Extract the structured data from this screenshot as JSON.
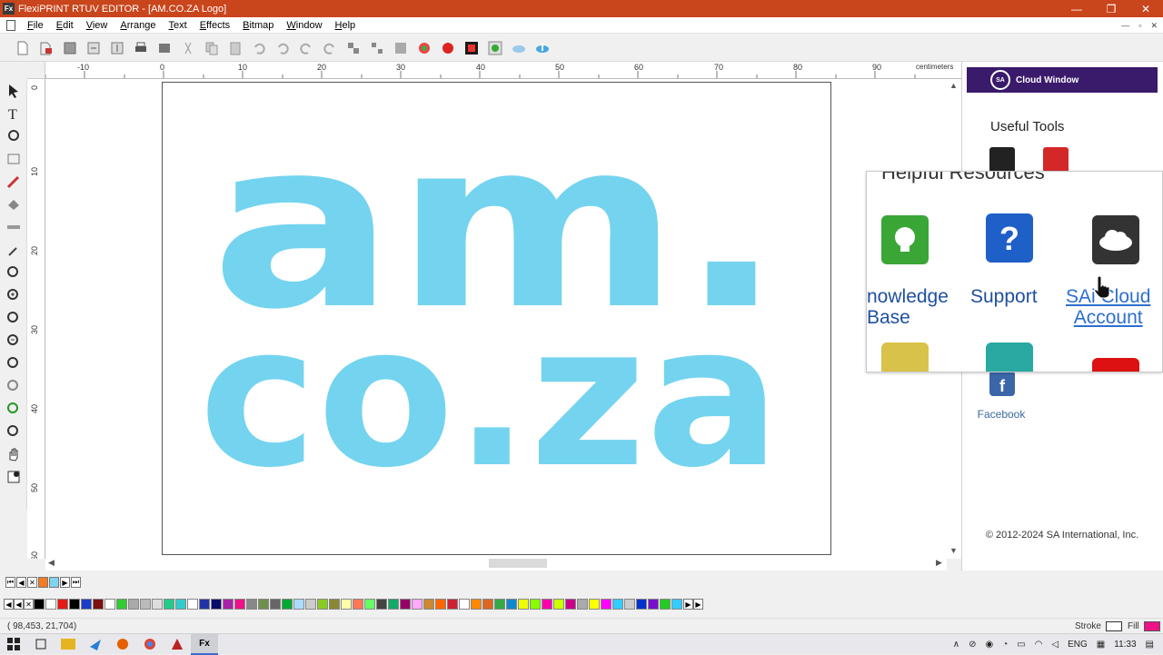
{
  "window": {
    "title": "FlexiPRINT RTUV EDITOR - [AM.CO.ZA Logo]",
    "app_icon_text": "Fx",
    "controls": [
      "—",
      "❐",
      "✕"
    ]
  },
  "menu": {
    "items": [
      "File",
      "Edit",
      "View",
      "Arrange",
      "Text",
      "Effects",
      "Bitmap",
      "Window",
      "Help"
    ],
    "mdi_controls": [
      "—",
      "▫",
      "✕"
    ]
  },
  "ruler": {
    "unit": "centimeters",
    "h_labels": [
      "-10",
      "0",
      "10",
      "20",
      "30",
      "40",
      "50",
      "60",
      "70",
      "80",
      "90"
    ],
    "v_labels": [
      "0",
      "10",
      "20",
      "30",
      "40",
      "50",
      "60"
    ]
  },
  "logo": {
    "line1": "am.",
    "line2": "co.za",
    "color": "#74d4ef"
  },
  "cloud_panel": {
    "header": "Cloud Window",
    "logo_text": "SA",
    "useful_tools": "Useful Tools",
    "helpful_resources": "Helpful Resources",
    "resources": [
      {
        "label": "nowledge\nBase",
        "icon": "lightbulb-icon",
        "color": "#3aa636"
      },
      {
        "label": "Support",
        "icon": "question-icon",
        "color": "#1f5fc8"
      },
      {
        "label": "SAi Cloud\nAccount",
        "icon": "cloud-icon",
        "color": "#333333"
      }
    ],
    "facebook": "Facebook",
    "copyright": "© 2012-2024 SA International, Inc."
  },
  "status": {
    "coords": "( 98,453,   21,704)",
    "stroke_label": "Stroke",
    "fill_label": "Fill",
    "fill_color": "#ee1188"
  },
  "taskbar": {
    "active_app": "Fx",
    "lang": "ENG",
    "time": "11:33"
  },
  "palette": {
    "colors": [
      "#000000",
      "#ffffff",
      "#e41b17",
      "#000000",
      "#1a3cc8",
      "#7a1010",
      "#ffffff",
      "#33cc33",
      "#aaaaaa",
      "#bbbbbb",
      "#dddddd",
      "#22cc88",
      "#33cccc",
      "#ffffff",
      "#2233aa",
      "#0a0a6a",
      "#aa22aa",
      "#ee1188",
      "#888888",
      "#6f8f4f",
      "#666666",
      "#00aa33",
      "#aaddff",
      "#cccccc",
      "#88cc22",
      "#888833",
      "#ffffaa",
      "#ff7755",
      "#66ff66",
      "#444444",
      "#11aa66",
      "#990066",
      "#ffaaff",
      "#cc8833",
      "#ff6600",
      "#cc2233",
      "#ffffff",
      "#ff8800",
      "#dd6622",
      "#33aa44",
      "#1188cc",
      "#eeff00",
      "#88ff00",
      "#ff00aa",
      "#ccff00",
      "#cc0088",
      "#aaaaaa",
      "#ffff00",
      "#ff00ff",
      "#33ccff",
      "#cccccc",
      "#0033cc",
      "#7711cc",
      "#22cc22",
      "#33ccff"
    ]
  }
}
